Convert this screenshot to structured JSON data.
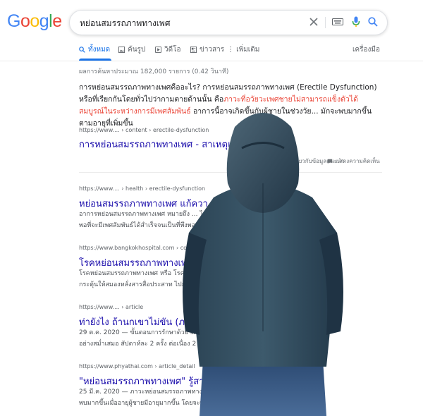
{
  "logo": {
    "letters": [
      "G",
      "o",
      "o",
      "g",
      "l",
      "e"
    ],
    "colors": [
      "#4285F4",
      "#EA4335",
      "#FBBC05",
      "#4285F4",
      "#34A853",
      "#EA4335"
    ]
  },
  "search": {
    "query": "หย่อนสมรรถภาพทางเพศ"
  },
  "tabs": [
    {
      "label": "ทั้งหมด",
      "icon": "search-icon"
    },
    {
      "label": "ค้นรูป",
      "icon": "image-icon"
    },
    {
      "label": "วิดีโอ",
      "icon": "video-icon"
    },
    {
      "label": "ข่าวสาร",
      "icon": "news-icon"
    },
    {
      "label": "⋮ เพิ่มเติม",
      "icon": "more-icon"
    }
  ],
  "tools": "เครื่องมือ",
  "stats": "ผลการค้นหาประมาณ 182,000 รายการ (0.42 วินาที)",
  "snippet": {
    "p1": "การหย่อนสมรรถภาพทางเพศคืออะไร? การหย่อนสมรรถภาพทางเพศ (Erectile Dysfunction) หรือที่เรียกกันโดยทั่วไปว่ากามตายด้านนั้น คือ",
    "hl": "ภาวะที่อวัยวะเพศชายไม่สามารถแข็งตัวได้สมบูรณ์ในระหว่างการมีเพศสัมพันธ์",
    "p2": " อาการนี้อาจเกิดขึ้นกับผู้ชายในช่วงวัย... มักจะพบมากขึ้นตามอายุที่เพิ่มขึ้น"
  },
  "featured": {
    "url": "https://www.... › content › erectile-dysfunction",
    "title": "การหย่อนสมรรถภาพทางเพศ - สาเหตุและ... ราษฎร์",
    "about": "เกี่ยวกับข้อมูลแนะนำ",
    "feedback": "แสดงความคิดเห็น"
  },
  "results": [
    {
      "url": "https://www.... › health › erectile-dysfunction",
      "title": "หย่อนสมรรถภาพทางเพศ แก้ควา...",
      "desc1": "อาการหย่อนสมรรถภาพทางเพศ หมายถึง ... ได้ไม่นาน",
      "desc2": "พอที่จะมีเพศสัมพันธ์ได้สำเร็จจนเป็นที่พึงพอ..."
    },
    {
      "url": "https://www.bangkokhospital.com › content",
      "title": "โรคหย่อนสมรรถภาพทางเพศ ...",
      "desc1": "โรคหย่อนสมรรถภาพทางเพศ หรือ โรคเสื่อ... สิ่งเร้า",
      "desc2": "กระตุ้นให้สมองหลั่งสารสื่อประสาท ไปกระ..."
    },
    {
      "url": "https://www.... › article",
      "title": "ท่ายังไง ถ้านกเขาไม่ขัน (ภาว...",
      "desc1": "29 ต.ค. 2020 — ขั้นตอนการรักษาด้วย sho... ผู้ชายต้องทำ",
      "desc2": "อย่างสม่ำเสมอ สัปดาห์ละ 2 ครั้ง ต่อเนื่อง 2 ..."
    },
    {
      "url": "https://www.phyathai.com › article_detail",
      "title": "\"หย่อนสมรรถภาพทางเพศ\" รู้สาเห... Hospital",
      "desc1": "25 มี.ค. 2020 — ภาวะหย่อนสมรรถภาพทางเพศ... กอายุ แต่จะ",
      "desc2": "พบมากขึ้นเมื่ออายุผู้ชายมีอายุมากขึ้น โดยจะพบได้..."
    }
  ]
}
